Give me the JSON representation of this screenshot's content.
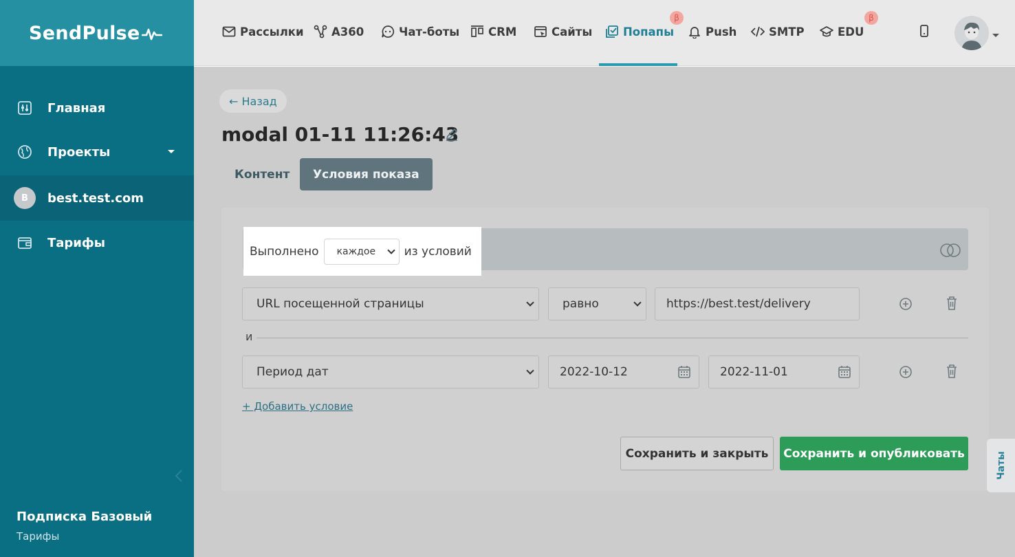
{
  "brand": {
    "name": "SendPulse"
  },
  "sidebar": {
    "items": [
      {
        "label": "Главная",
        "icon": "dashboard-icon"
      },
      {
        "label": "Проекты",
        "icon": "globe-icon"
      },
      {
        "label": "best.test.com",
        "avatar_letter": "B"
      },
      {
        "label": "Тарифы",
        "icon": "wallet-icon"
      }
    ],
    "plan_title": "Подписка Базовый",
    "plan_link": "Тарифы"
  },
  "topnav": {
    "items": [
      {
        "label": "Рассылки",
        "icon": "mail-icon"
      },
      {
        "label": "A360",
        "icon": "flow-icon"
      },
      {
        "label": "Чат-боты",
        "icon": "chatbot-icon"
      },
      {
        "label": "CRM",
        "icon": "crm-icon"
      },
      {
        "label": "Сайты",
        "icon": "site-icon"
      },
      {
        "label": "Попапы",
        "icon": "popup-icon",
        "beta": "β"
      },
      {
        "label": "Push",
        "icon": "bell-icon"
      },
      {
        "label": "SMTP",
        "icon": "code-icon"
      },
      {
        "label": "EDU",
        "icon": "graduation-cap-icon",
        "beta": "β"
      }
    ],
    "active": "Попапы"
  },
  "main": {
    "back_label": "← Назад",
    "title": "modal 01-11 11:26:43",
    "tabs": [
      {
        "label": "Контент"
      },
      {
        "label": "Условия показа"
      }
    ],
    "active_tab": "Условия показа",
    "conditions": {
      "prefix": "Выполнено",
      "mode": "каждое",
      "suffix": "из условий",
      "rows": [
        {
          "field": "URL посещенной страницы",
          "operator": "равно",
          "value": "https://best.test/delivery"
        },
        {
          "field": "Период дат",
          "date_from": "2022-10-12",
          "date_to": "2022-11-01"
        }
      ],
      "joiner": "и",
      "add_label": "+ Добавить условие"
    },
    "save_close_label": "Сохранить и закрыть",
    "save_publish_label": "Сохранить и опубликовать"
  },
  "chats_tab": "Чаты",
  "colors": {
    "sidebar": "#0b6f84",
    "accent": "#2a98ad",
    "publish_button": "#2c9c58"
  }
}
